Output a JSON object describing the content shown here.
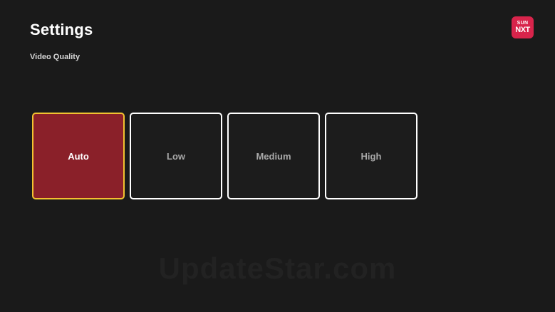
{
  "header": {
    "title": "Settings",
    "section_label": "Video Quality"
  },
  "logo": {
    "line1": "SUN",
    "line2": "NXT",
    "brand_color": "#d8244b"
  },
  "video_quality": {
    "selected": "Auto",
    "options": [
      {
        "label": "Auto"
      },
      {
        "label": "Low"
      },
      {
        "label": "Medium"
      },
      {
        "label": "High"
      }
    ],
    "colors": {
      "selected_fill": "#8a2029",
      "selected_border": "#f2c230",
      "border": "#ffffff",
      "background": "#1a1a1a"
    }
  },
  "watermark": {
    "text": "UpdateStar.com"
  }
}
